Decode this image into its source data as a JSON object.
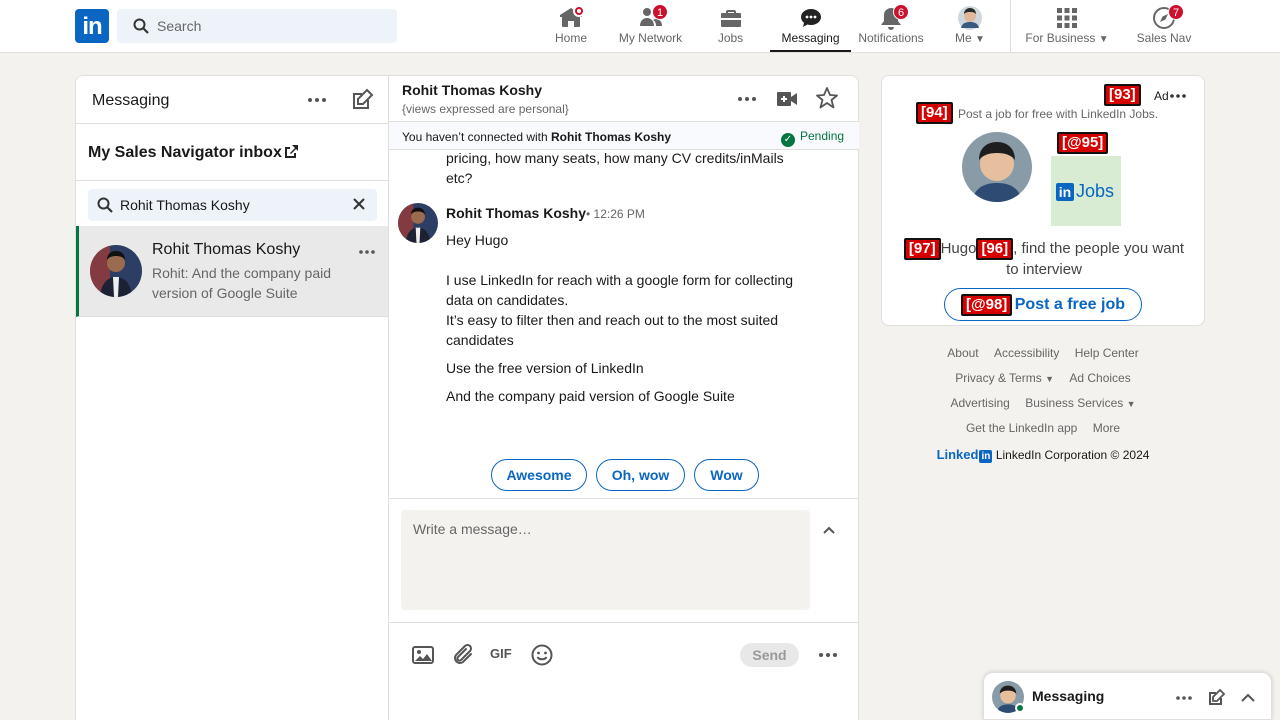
{
  "nav": {
    "search_placeholder": "Search",
    "items": [
      {
        "label": "Home",
        "badge": ""
      },
      {
        "label": "My Network",
        "badge": "1"
      },
      {
        "label": "Jobs",
        "badge": ""
      },
      {
        "label": "Messaging",
        "badge": ""
      },
      {
        "label": "Notifications",
        "badge": "6"
      },
      {
        "label": "Me",
        "badge": ""
      },
      {
        "label": "For Business",
        "badge": ""
      },
      {
        "label": "Sales Nav",
        "badge": "7"
      }
    ]
  },
  "messaging": {
    "title": "Messaging",
    "inbox_label": "My Sales Navigator inbox",
    "search_query": "Rohit Thomas Koshy",
    "conversation": {
      "name": "Rohit Thomas Koshy",
      "preview": "Rohit: And the company paid version of Google Suite"
    }
  },
  "thread": {
    "name": "Rohit Thomas Koshy",
    "subtitle": "{views expressed are personal}",
    "connection_prefix": "You haven’t connected with ",
    "connection_name": "Rohit Thomas Koshy",
    "pending_label": "Pending",
    "continuation": "pricing, how many seats, how many CV credits/inMails etc?",
    "sender": "Rohit Thomas Koshy",
    "time": "• 12:26 PM",
    "messages": [
      "Hey Hugo",
      "I use LinkedIn for reach with a google form for collecting data on candidates.",
      "It’s easy to filter then and reach out to the most suited candidates",
      "Use the free version of LinkedIn",
      "And the company paid version of Google Suite"
    ],
    "reactions": [
      "Awesome",
      "Oh, wow",
      "Wow"
    ],
    "composer_placeholder": "Write a message…",
    "gif_label": "GIF",
    "send_label": "Send"
  },
  "ad": {
    "ad_label": "Ad",
    "tags": [
      "[93]",
      "[94]",
      "[@95]",
      "[97]",
      "[96]",
      "[@98]"
    ],
    "line1": "Post a job for free with LinkedIn Jobs.",
    "jobs_logo_text": "Jobs",
    "headline_a": "Hugo",
    "headline_b": ", find the people you want to interview",
    "cta": "Post a free job"
  },
  "footer": {
    "row1": [
      "About",
      "Accessibility",
      "Help Center"
    ],
    "row2": [
      "Privacy & Terms",
      "Ad Choices"
    ],
    "row3": [
      "Advertising",
      "Business Services"
    ],
    "row4": [
      "Get the LinkedIn app",
      "More"
    ],
    "brand": "Linked",
    "copyright": "LinkedIn Corporation © 2024"
  },
  "chatbar": {
    "title": "Messaging"
  },
  "colors": {
    "brand": "#0a66c2",
    "badge": "#cb112d",
    "active": "#057642"
  }
}
